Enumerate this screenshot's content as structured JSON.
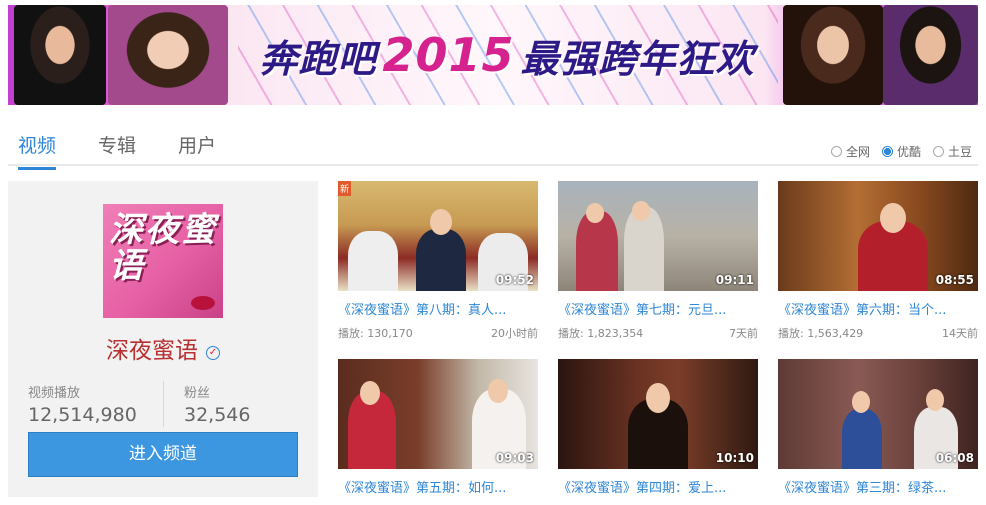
{
  "banner": {
    "slogan_left": "奔跑吧",
    "slogan_year": "2015",
    "slogan_right": "最强跨年狂欢"
  },
  "tabs": [
    {
      "label": "视频",
      "active": true
    },
    {
      "label": "专辑",
      "active": false
    },
    {
      "label": "用户",
      "active": false
    }
  ],
  "source_filter": [
    {
      "label": "全网",
      "selected": false
    },
    {
      "label": "优酷",
      "selected": true
    },
    {
      "label": "土豆",
      "selected": false
    }
  ],
  "channel": {
    "cover_text": "深夜蜜语",
    "name": "深夜蜜语",
    "verified_icon": "verified-icon",
    "plays_label": "视频播放",
    "plays_value": "12,514,980",
    "fans_label": "粉丝",
    "fans_value": "32,546",
    "enter_button": "进入频道",
    "accent_color": "#3d97e0",
    "name_color": "#b83030"
  },
  "videos": [
    {
      "title": "《深夜蜜语》第八期：真人...",
      "duration": "09:52",
      "plays": "播放: 130,170",
      "time": "20小时前",
      "badge": "新"
    },
    {
      "title": "《深夜蜜语》第七期：元旦...",
      "duration": "09:11",
      "plays": "播放: 1,823,354",
      "time": "7天前"
    },
    {
      "title": "《深夜蜜语》第六期：当个...",
      "duration": "08:55",
      "plays": "播放: 1,563,429",
      "time": "14天前"
    },
    {
      "title": "《深夜蜜语》第五期：如何...",
      "duration": "09:03",
      "plays": "",
      "time": ""
    },
    {
      "title": "《深夜蜜语》第四期：爱上...",
      "duration": "10:10",
      "plays": "",
      "time": ""
    },
    {
      "title": "《深夜蜜语》第三期：绿茶...",
      "duration": "06:08",
      "plays": "",
      "time": ""
    }
  ]
}
